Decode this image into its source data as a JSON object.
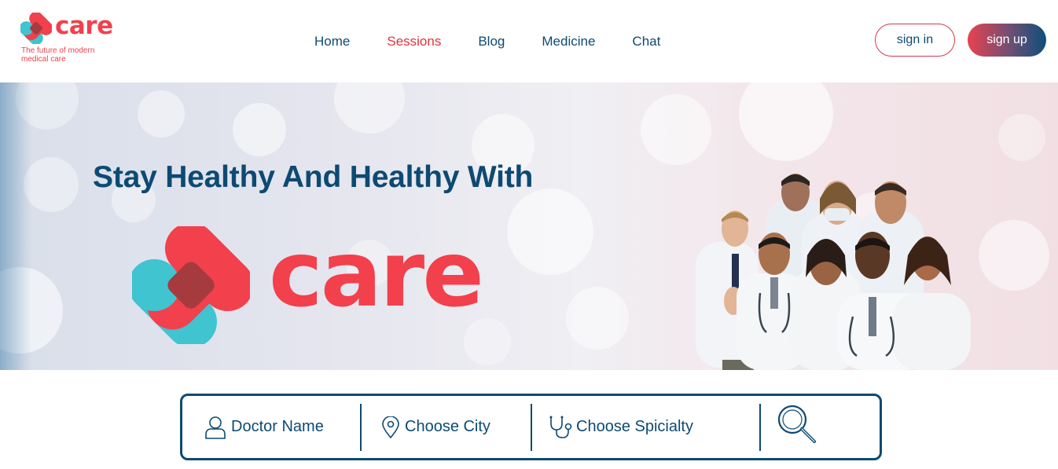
{
  "brand": {
    "name": "care",
    "tagline": "The future of modern medical care",
    "colors": {
      "red": "#f2404c",
      "teal": "#3fc4d0",
      "navy": "#0d4a73"
    }
  },
  "nav": {
    "items": [
      {
        "label": "Home",
        "active": false
      },
      {
        "label": "Sessions",
        "active": true
      },
      {
        "label": "Blog",
        "active": false
      },
      {
        "label": "Medicine",
        "active": false
      },
      {
        "label": "Chat",
        "active": false
      }
    ]
  },
  "auth": {
    "signin_label": "sign in",
    "signup_label": "sign up"
  },
  "hero": {
    "title": "Stay Healthy And Healthy With",
    "brand_word": "care",
    "image": "group-of-doctors-photo"
  },
  "search": {
    "doctor": {
      "label": "Doctor Name",
      "icon": "user-icon"
    },
    "city": {
      "label": "Choose City",
      "icon": "location-pin-icon"
    },
    "specialty": {
      "label": "Choose Spicialty",
      "icon": "stethoscope-icon"
    },
    "submit_icon": "magnifier-icon"
  }
}
